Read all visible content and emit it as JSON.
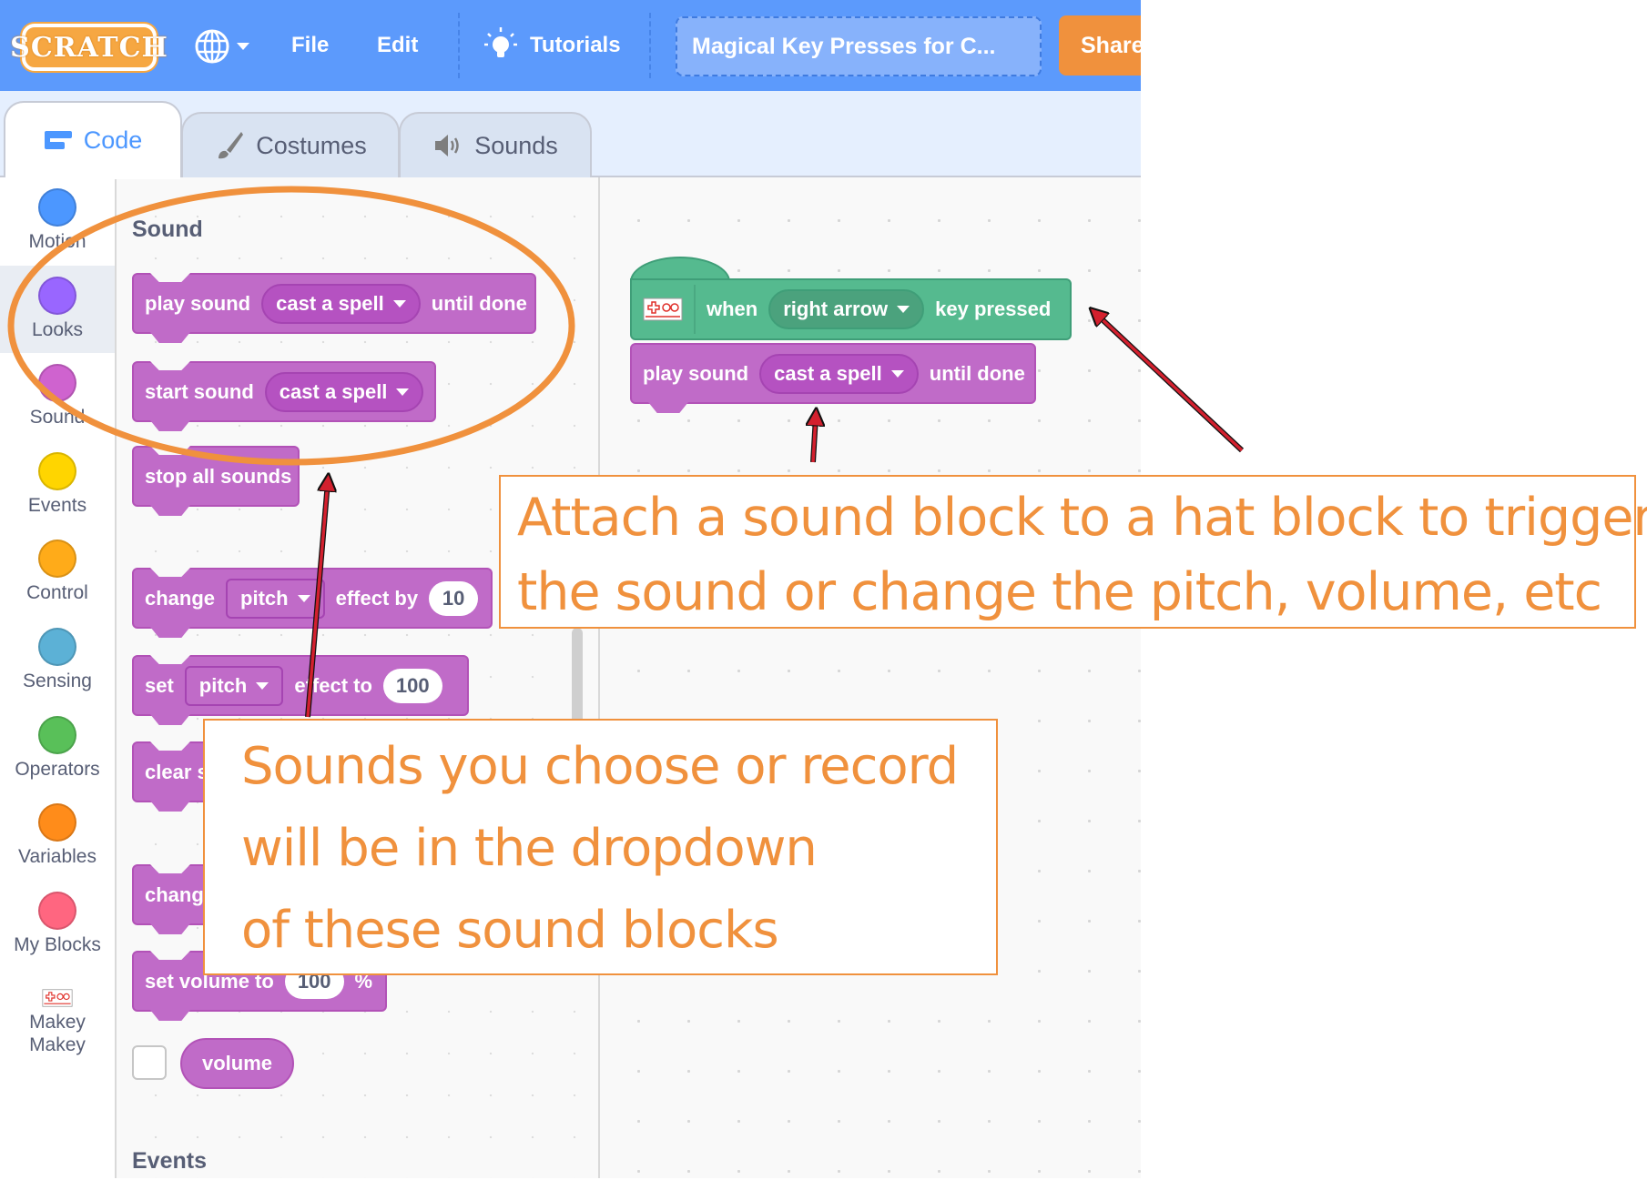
{
  "menubar": {
    "logo": "SCRATCH",
    "language_icon": "globe-icon",
    "items": [
      "File",
      "Edit"
    ],
    "tutorials": "Tutorials",
    "project_title": "Magical Key Presses for C...",
    "share": "Share"
  },
  "tabs": [
    {
      "label": "Code",
      "icon": "code-icon",
      "active": true
    },
    {
      "label": "Costumes",
      "icon": "brush-icon",
      "active": false
    },
    {
      "label": "Sounds",
      "icon": "speaker-icon",
      "active": false
    }
  ],
  "categories": [
    {
      "label": "Motion",
      "color": "#4c97ff",
      "selected": false
    },
    {
      "label": "Looks",
      "color": "#9966ff",
      "selected": true
    },
    {
      "label": "Sound",
      "color": "#cf63cf",
      "selected": false
    },
    {
      "label": "Events",
      "color": "#ffd500",
      "selected": false
    },
    {
      "label": "Control",
      "color": "#ffab19",
      "selected": false
    },
    {
      "label": "Sensing",
      "color": "#5cb1d6",
      "selected": false
    },
    {
      "label": "Operators",
      "color": "#59c059",
      "selected": false
    },
    {
      "label": "Variables",
      "color": "#ff8c1a",
      "selected": false
    },
    {
      "label": "My Blocks",
      "color": "#ff6680",
      "selected": false
    },
    {
      "label": "Makey Makey",
      "icon": "makey-makey-icon",
      "selected": false
    }
  ],
  "palette": {
    "section_sound": "Sound",
    "section_events": "Events",
    "blocks": {
      "play_sound": {
        "before": "play sound",
        "menu": "cast a spell",
        "after": "until done"
      },
      "start_sound": {
        "before": "start sound",
        "menu": "cast a spell"
      },
      "stop_all": {
        "label": "stop all sounds"
      },
      "change_effect": {
        "before": "change",
        "menu": "pitch",
        "middle": "effect by",
        "value": "10"
      },
      "set_effect": {
        "before": "set",
        "menu": "pitch",
        "middle": "effect to",
        "value": "100"
      },
      "clear_effects": {
        "label": "clear s"
      },
      "change_volume": {
        "label": "chang"
      },
      "set_volume": {
        "before": "set volume to",
        "value": "100",
        "after": "%"
      },
      "volume_reporter": {
        "label": "volume",
        "checked": false
      }
    }
  },
  "workspace": {
    "hat": {
      "before": "when",
      "menu": "right arrow",
      "after": "key pressed",
      "icon": "makey-makey-icon"
    },
    "play_sound": {
      "before": "play sound",
      "menu": "cast a spell",
      "after": "until done"
    }
  },
  "annotations": {
    "callout_attach": [
      "Attach a sound block to a hat block to trigger",
      "the sound or change the pitch, volume, etc"
    ],
    "callout_sounds": [
      "Sounds you choose or record",
      "will be in the dropdown",
      "of these sound blocks"
    ],
    "highlight_color": "#f0913d",
    "arrow_color": "#d3202e"
  }
}
